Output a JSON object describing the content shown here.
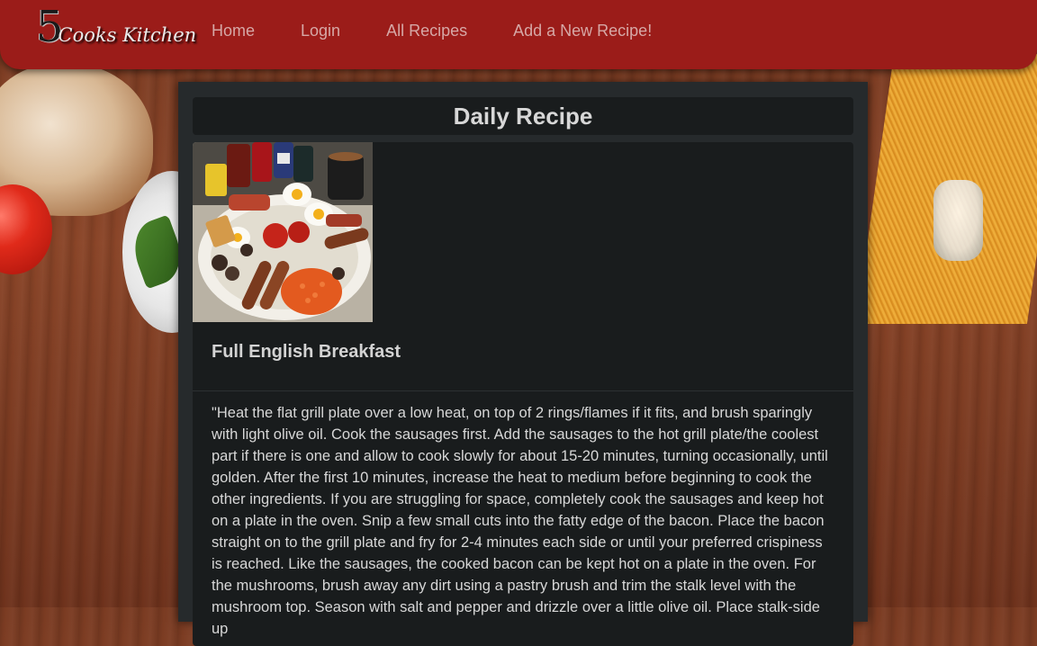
{
  "brand": {
    "number": "5",
    "name": "Cooks Kitchen"
  },
  "nav": {
    "items": [
      {
        "label": "Home"
      },
      {
        "label": "Login"
      },
      {
        "label": "All Recipes"
      },
      {
        "label": "Add a New Recipe!"
      }
    ]
  },
  "page": {
    "title": "Daily Recipe"
  },
  "recipe": {
    "name": "Full English Breakfast",
    "image_icon": "full-english-breakfast-photo",
    "instructions": "\"Heat the flat grill plate over a low heat, on top of 2 rings/flames if it fits, and brush sparingly with light olive oil. Cook the sausages first. Add the sausages to the hot grill plate/the coolest part if there is one and allow to cook slowly for about 15-20 minutes, turning occasionally, until golden. After the first 10 minutes, increase the heat to medium before beginning to cook the other ingredients. If you are struggling for space, completely cook the sausages and keep hot on a plate in the oven. Snip a few small cuts into the fatty edge of the bacon. Place the bacon straight on to the grill plate and fry for 2-4 minutes each side or until your preferred crispiness is reached. Like the sausages, the cooked bacon can be kept hot on a plate in the oven. For the mushrooms, brush away any dirt using a pastry brush and trim the stalk level with the mushroom top. Season with salt and pepper and drizzle over a little olive oil. Place stalk-side up"
  },
  "colors": {
    "navbar": "#9b1c19",
    "nav_link": "#d6a8a6",
    "card_bg": "#191c1d",
    "container_bg": "#262a2c",
    "text": "#d7d7d7"
  }
}
